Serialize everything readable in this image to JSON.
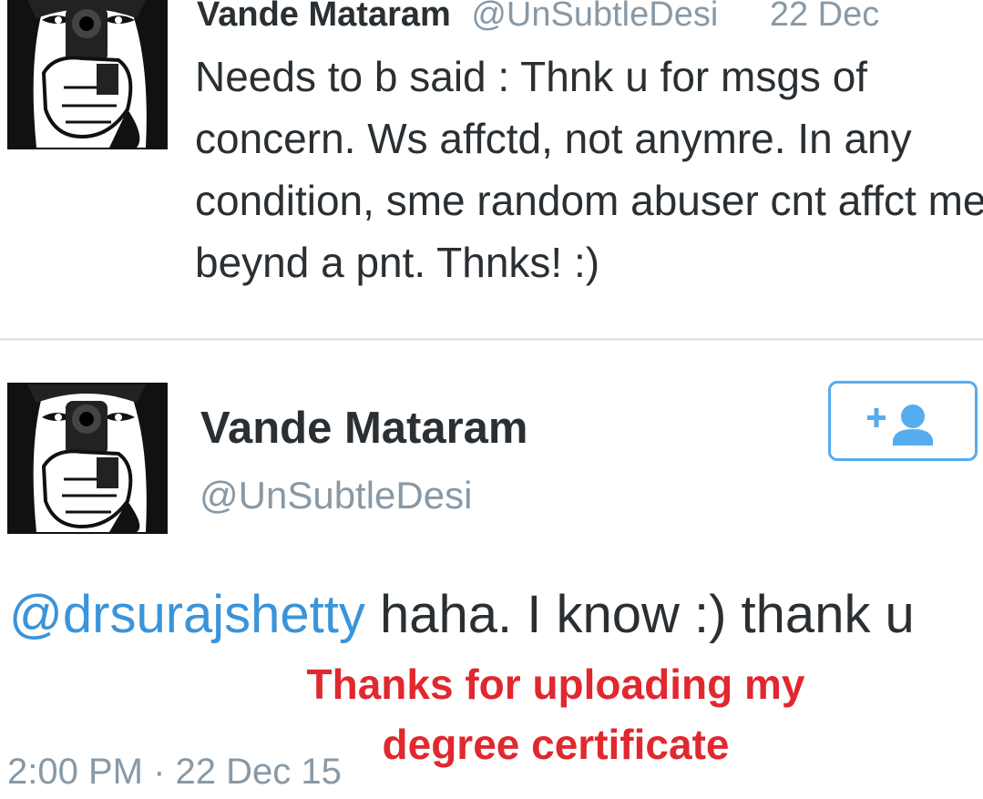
{
  "tweet1": {
    "display_name": "Vande Mataram",
    "handle": "@UnSubtleDesi",
    "time": "22 Dec",
    "text": "Needs to b said : Thnk u for msgs of concern. Ws affctd, not anymre. In any condition, sme random abuser cnt affct me beynd a pnt. Thnks! :)"
  },
  "tweet2": {
    "display_name": "Vande Mataram",
    "handle": "@UnSubtleDesi",
    "mention": "@drsurajshetty",
    "text": " haha. I know :) thank u",
    "timestamp": "2:00 PM · 22 Dec 15",
    "follow_icon": "add-user-icon"
  },
  "overlay": {
    "caption": "Thanks for uploading my degree certificate"
  },
  "colors": {
    "text": "#292f33",
    "muted": "#8899a6",
    "link": "#3b94d9",
    "accent": "#55acee",
    "divider": "#e1e8ed",
    "overlay_red": "#e0282e"
  },
  "icons": {
    "avatar": "profile-avatar"
  }
}
